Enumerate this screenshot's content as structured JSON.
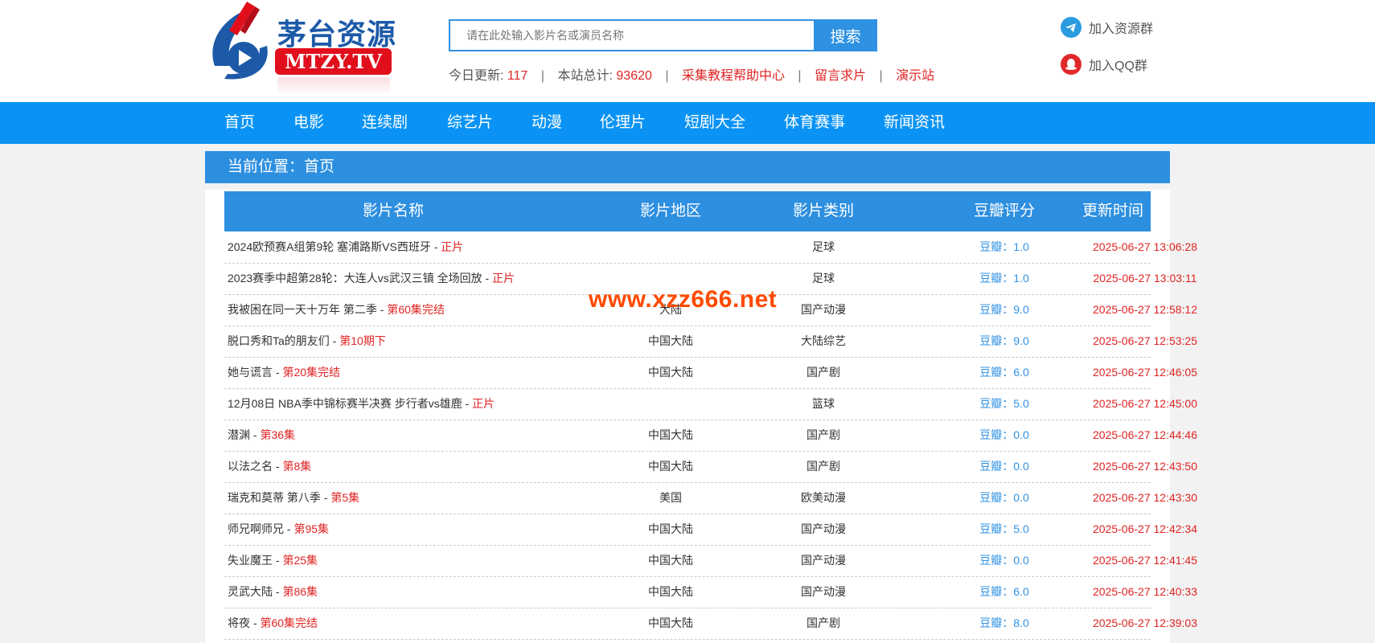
{
  "brand": {
    "name": "茅台资源",
    "badge": "MTZY.TV"
  },
  "search": {
    "placeholder": "请在此处输入影片名或演员名称",
    "button": "搜索"
  },
  "stats": {
    "today_label": "今日更新:",
    "today_value": "117",
    "total_label": "本站总计:",
    "total_value": "93620",
    "links": [
      "采集教程帮助中心",
      "留言求片",
      "演示站"
    ]
  },
  "groups": {
    "telegram": "加入资源群",
    "qq": "加入QQ群"
  },
  "nav": [
    "首页",
    "电影",
    "连续剧",
    "综艺片",
    "动漫",
    "伦理片",
    "短剧大全",
    "体育赛事",
    "新闻资讯"
  ],
  "breadcrumb": "当前位置：首页",
  "table": {
    "headers": [
      "影片名称",
      "影片地区",
      "影片类别",
      "豆瓣评分",
      "更新时间"
    ],
    "rows": [
      {
        "name": "2024欧预赛A组第9轮 塞浦路斯VS西班牙",
        "ep": "正片",
        "area": "",
        "type": "足球",
        "score": "豆瓣：1.0",
        "time": "2025-06-27 13:06:28"
      },
      {
        "name": "2023赛季中超第28轮：大连人vs武汉三镇 全场回放",
        "ep": "正片",
        "area": "",
        "type": "足球",
        "score": "豆瓣：1.0",
        "time": "2025-06-27 13:03:11"
      },
      {
        "name": "我被困在同一天十万年 第二季",
        "ep": "第60集完结",
        "area": "大陆",
        "type": "国产动漫",
        "score": "豆瓣：9.0",
        "time": "2025-06-27 12:58:12"
      },
      {
        "name": "脱口秀和Ta的朋友们",
        "ep": "第10期下",
        "area": "中国大陆",
        "type": "大陆综艺",
        "score": "豆瓣：9.0",
        "time": "2025-06-27 12:53:25"
      },
      {
        "name": "她与谎言",
        "ep": "第20集完结",
        "area": "中国大陆",
        "type": "国产剧",
        "score": "豆瓣：6.0",
        "time": "2025-06-27 12:46:05"
      },
      {
        "name": "12月08日 NBA季中锦标赛半决赛 步行者vs雄鹿",
        "ep": "正片",
        "area": "",
        "type": "篮球",
        "score": "豆瓣：5.0",
        "time": "2025-06-27 12:45:00"
      },
      {
        "name": "潜渊",
        "ep": "第36集",
        "area": "中国大陆",
        "type": "国产剧",
        "score": "豆瓣：0.0",
        "time": "2025-06-27 12:44:46"
      },
      {
        "name": "以法之名",
        "ep": "第8集",
        "area": "中国大陆",
        "type": "国产剧",
        "score": "豆瓣：0.0",
        "time": "2025-06-27 12:43:50"
      },
      {
        "name": "瑞克和莫蒂 第八季",
        "ep": "第5集",
        "area": "美国",
        "type": "欧美动漫",
        "score": "豆瓣：0.0",
        "time": "2025-06-27 12:43:30"
      },
      {
        "name": "师兄啊师兄",
        "ep": "第95集",
        "area": "中国大陆",
        "type": "国产动漫",
        "score": "豆瓣：5.0",
        "time": "2025-06-27 12:42:34"
      },
      {
        "name": "失业魔王",
        "ep": "第25集",
        "area": "中国大陆",
        "type": "国产动漫",
        "score": "豆瓣：0.0",
        "time": "2025-06-27 12:41:45"
      },
      {
        "name": "灵武大陆",
        "ep": "第86集",
        "area": "中国大陆",
        "type": "国产动漫",
        "score": "豆瓣：6.0",
        "time": "2025-06-27 12:40:33"
      },
      {
        "name": "将夜",
        "ep": "第60集完结",
        "area": "中国大陆",
        "type": "国产剧",
        "score": "豆瓣：8.0",
        "time": "2025-06-27 12:39:03"
      }
    ]
  },
  "watermark": "www.xzz666.net"
}
